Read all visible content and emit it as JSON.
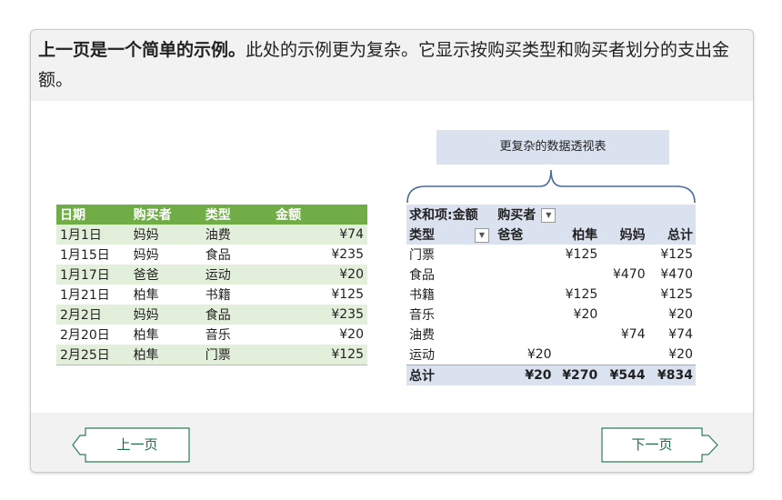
{
  "intro": {
    "bold": "上一页是一个简单的示例。",
    "text": "此处的示例更为复杂。它显示按购买类型和购买者划分的支出金额。"
  },
  "source_table": {
    "headers": [
      "日期",
      "购买者",
      "类型",
      "金额"
    ],
    "rows": [
      [
        "1月1日",
        "妈妈",
        "油费",
        "¥74"
      ],
      [
        "1月15日",
        "妈妈",
        "食品",
        "¥235"
      ],
      [
        "1月17日",
        "爸爸",
        "运动",
        "¥20"
      ],
      [
        "1月21日",
        "柏隼",
        "书籍",
        "¥125"
      ],
      [
        "2月2日",
        "妈妈",
        "食品",
        "¥235"
      ],
      [
        "2月20日",
        "柏隼",
        "音乐",
        "¥20"
      ],
      [
        "2月25日",
        "柏隼",
        "门票",
        "¥125"
      ]
    ]
  },
  "callout": {
    "label": "更复杂的数据透视表"
  },
  "pivot": {
    "sum_label": "求和项:金额",
    "col_field": "购买者",
    "row_field": "类型",
    "columns": [
      "爸爸",
      "柏隼",
      "妈妈",
      "总计"
    ],
    "rows": [
      [
        "门票",
        "",
        "¥125",
        "",
        "¥125"
      ],
      [
        "食品",
        "",
        "",
        "¥470",
        "¥470"
      ],
      [
        "书籍",
        "",
        "¥125",
        "",
        "¥125"
      ],
      [
        "音乐",
        "",
        "¥20",
        "",
        "¥20"
      ],
      [
        "油费",
        "",
        "",
        "¥74",
        "¥74"
      ],
      [
        "运动",
        "¥20",
        "",
        "",
        "¥20"
      ]
    ],
    "total": [
      "总计",
      "¥20",
      "¥270",
      "¥544",
      "¥834"
    ]
  },
  "nav": {
    "prev_label": "上一页",
    "next_label": "下一页"
  },
  "colors": {
    "header_green": "#70ad47",
    "band_green": "#e2efda",
    "pivot_blue": "#dae2f0",
    "nav_green": "#1f6b4a"
  }
}
